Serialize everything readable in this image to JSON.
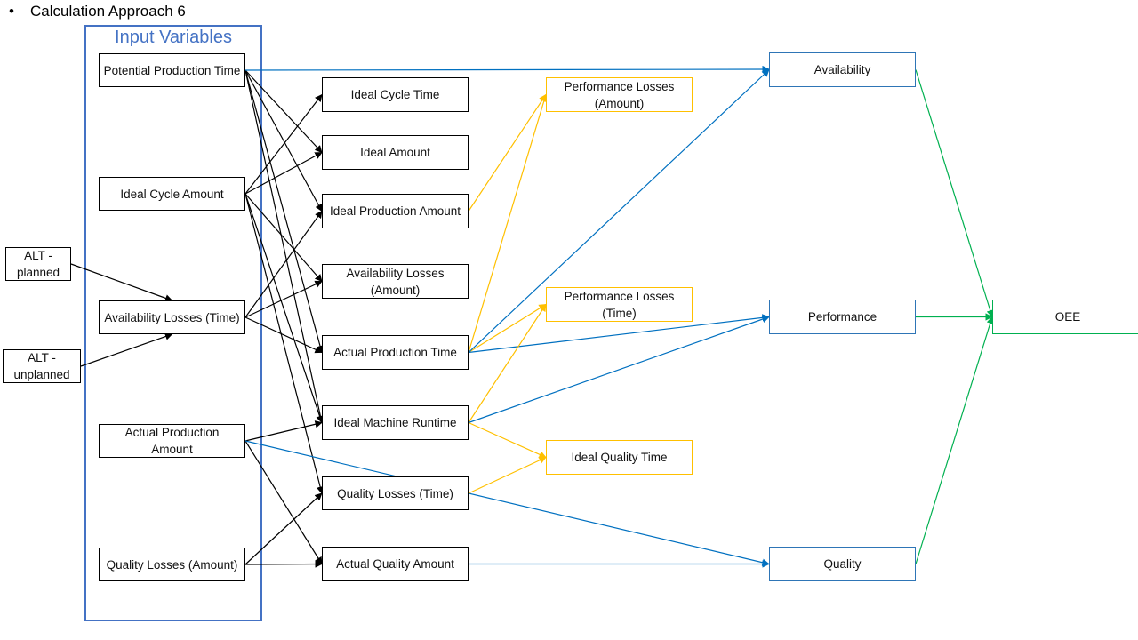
{
  "title": "Calculation Approach 6",
  "group_label": "Input Variables",
  "colors": {
    "black": "#000000",
    "yellow": "#ffc000",
    "blue": "#0070c0",
    "green": "#00b050",
    "group": "#4472c4"
  },
  "nodes": {
    "potential_production_time": {
      "label": "Potential Production Time",
      "category": "input"
    },
    "ideal_cycle_amount": {
      "label": "Ideal Cycle Amount",
      "category": "input"
    },
    "availability_losses_time": {
      "label": "Availability Losses (Time)",
      "category": "input"
    },
    "actual_production_amount": {
      "label": "Actual Production Amount",
      "category": "input"
    },
    "quality_losses_amount": {
      "label": "Quality Losses (Amount)",
      "category": "input"
    },
    "alt_planned": {
      "label": "ALT - planned",
      "category": "source"
    },
    "alt_unplanned": {
      "label": "ALT - unplanned",
      "category": "source"
    },
    "ideal_cycle_time": {
      "label": "Ideal Cycle Time",
      "category": "intermediate"
    },
    "ideal_amount": {
      "label": "Ideal Amount",
      "category": "intermediate"
    },
    "ideal_production_amount": {
      "label": "Ideal Production Amount",
      "category": "intermediate"
    },
    "availability_losses_amount": {
      "label": "Availability Losses (Amount)",
      "category": "intermediate"
    },
    "actual_production_time": {
      "label": "Actual Production Time",
      "category": "intermediate"
    },
    "ideal_machine_runtime": {
      "label": "Ideal Machine Runtime",
      "category": "intermediate"
    },
    "quality_losses_time": {
      "label": "Quality Losses (Time)",
      "category": "intermediate"
    },
    "actual_quality_amount": {
      "label": "Actual Quality Amount",
      "category": "intermediate"
    },
    "performance_losses_amount": {
      "label": "Performance Losses (Amount)",
      "category": "loss"
    },
    "performance_losses_time": {
      "label": "Performance Losses (Time)",
      "category": "loss"
    },
    "ideal_quality_time": {
      "label": "Ideal Quality Time",
      "category": "loss"
    },
    "availability": {
      "label": "Availability",
      "category": "kpi"
    },
    "performance": {
      "label": "Performance",
      "category": "kpi"
    },
    "quality": {
      "label": "Quality",
      "category": "kpi"
    },
    "oee": {
      "label": "OEE",
      "category": "result"
    }
  },
  "edges": [
    {
      "from": "alt_planned",
      "to": "availability_losses_time",
      "color": "black"
    },
    {
      "from": "alt_unplanned",
      "to": "availability_losses_time",
      "color": "black"
    },
    {
      "from": "potential_production_time",
      "to": "ideal_amount",
      "color": "black"
    },
    {
      "from": "potential_production_time",
      "to": "ideal_production_amount",
      "color": "black"
    },
    {
      "from": "potential_production_time",
      "to": "actual_production_time",
      "color": "black"
    },
    {
      "from": "potential_production_time",
      "to": "ideal_machine_runtime",
      "color": "black"
    },
    {
      "from": "potential_production_time",
      "to": "availability",
      "color": "blue"
    },
    {
      "from": "ideal_cycle_amount",
      "to": "ideal_cycle_time",
      "color": "black"
    },
    {
      "from": "ideal_cycle_amount",
      "to": "ideal_amount",
      "color": "black"
    },
    {
      "from": "ideal_cycle_amount",
      "to": "availability_losses_amount",
      "color": "black"
    },
    {
      "from": "ideal_cycle_amount",
      "to": "ideal_machine_runtime",
      "color": "black"
    },
    {
      "from": "ideal_cycle_amount",
      "to": "quality_losses_time",
      "color": "black"
    },
    {
      "from": "availability_losses_time",
      "to": "ideal_production_amount",
      "color": "black"
    },
    {
      "from": "availability_losses_time",
      "to": "availability_losses_amount",
      "color": "black"
    },
    {
      "from": "availability_losses_time",
      "to": "actual_production_time",
      "color": "black"
    },
    {
      "from": "actual_production_amount",
      "to": "ideal_machine_runtime",
      "color": "black"
    },
    {
      "from": "actual_production_amount",
      "to": "actual_quality_amount",
      "color": "black"
    },
    {
      "from": "actual_production_amount",
      "to": "quality",
      "color": "blue"
    },
    {
      "from": "quality_losses_amount",
      "to": "quality_losses_time",
      "color": "black"
    },
    {
      "from": "quality_losses_amount",
      "to": "actual_quality_amount",
      "color": "black"
    },
    {
      "from": "ideal_production_amount",
      "to": "performance_losses_amount",
      "color": "yellow"
    },
    {
      "from": "actual_production_time",
      "to": "performance_losses_amount",
      "color": "yellow"
    },
    {
      "from": "actual_production_time",
      "to": "performance_losses_time",
      "color": "yellow"
    },
    {
      "from": "actual_production_time",
      "to": "availability",
      "color": "blue"
    },
    {
      "from": "actual_production_time",
      "to": "performance",
      "color": "blue"
    },
    {
      "from": "ideal_machine_runtime",
      "to": "performance_losses_time",
      "color": "yellow"
    },
    {
      "from": "ideal_machine_runtime",
      "to": "ideal_quality_time",
      "color": "yellow"
    },
    {
      "from": "ideal_machine_runtime",
      "to": "performance",
      "color": "blue"
    },
    {
      "from": "quality_losses_time",
      "to": "ideal_quality_time",
      "color": "yellow"
    },
    {
      "from": "actual_quality_amount",
      "to": "quality",
      "color": "blue"
    },
    {
      "from": "availability",
      "to": "oee",
      "color": "green"
    },
    {
      "from": "performance",
      "to": "oee",
      "color": "green"
    },
    {
      "from": "quality",
      "to": "oee",
      "color": "green"
    }
  ]
}
